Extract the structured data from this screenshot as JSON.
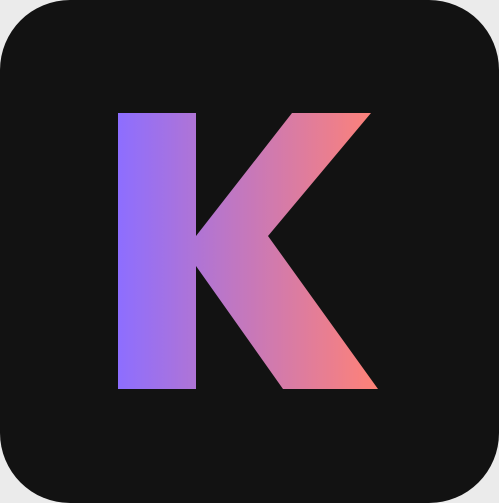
{
  "icon": {
    "name": "k-logo-icon",
    "letter": "K",
    "background_color": "#121212",
    "page_background": "#ebebeb",
    "gradient_start": "#8d6eff",
    "gradient_end": "#ff8276"
  }
}
